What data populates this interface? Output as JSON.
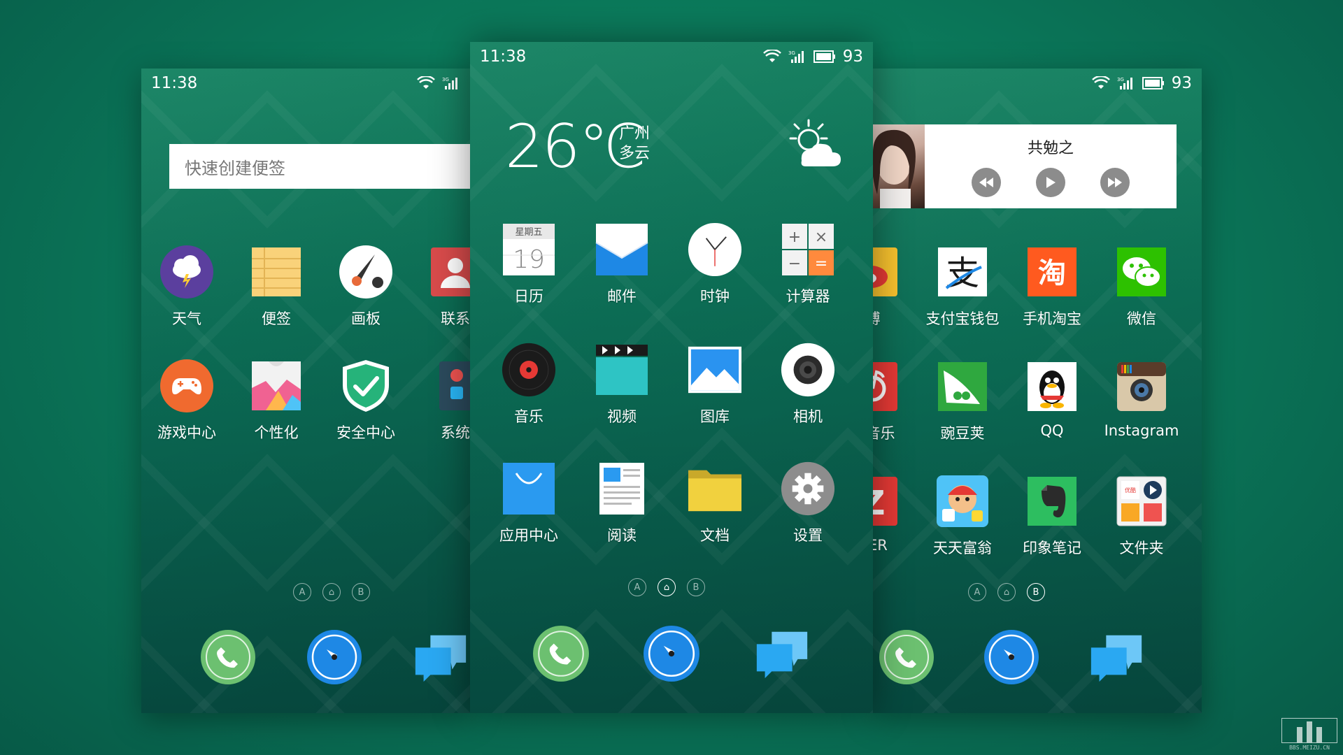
{
  "left_screen": {
    "status": {
      "time": "11:38"
    },
    "note_widget": {
      "placeholder": "快速创建便签"
    },
    "apps_row1": [
      {
        "label": "天气",
        "icon": "weather-icon"
      },
      {
        "label": "便签",
        "icon": "notes-icon"
      },
      {
        "label": "画板",
        "icon": "paint-palette-icon"
      },
      {
        "label": "联系",
        "icon": "contacts-icon"
      }
    ],
    "apps_row2": [
      {
        "label": "游戏中心",
        "icon": "gamepad-icon"
      },
      {
        "label": "个性化",
        "icon": "theme-shirt-icon"
      },
      {
        "label": "安全中心",
        "icon": "shield-check-icon"
      },
      {
        "label": "系统",
        "icon": "system-tools-icon"
      }
    ],
    "dots": [
      "A",
      "⌂",
      "B"
    ]
  },
  "center_screen": {
    "status": {
      "time": "11:38",
      "battery": "93"
    },
    "weather": {
      "temp": "26℃",
      "city": "广州",
      "condition": "多云"
    },
    "apps": [
      {
        "label": "日历",
        "icon": "calendar-icon",
        "weekday": "星期五",
        "day": "19"
      },
      {
        "label": "邮件",
        "icon": "mail-icon"
      },
      {
        "label": "时钟",
        "icon": "clock-icon"
      },
      {
        "label": "计算器",
        "icon": "calculator-icon"
      },
      {
        "label": "音乐",
        "icon": "music-disc-icon"
      },
      {
        "label": "视频",
        "icon": "video-clapper-icon"
      },
      {
        "label": "图库",
        "icon": "gallery-icon"
      },
      {
        "label": "相机",
        "icon": "camera-icon"
      },
      {
        "label": "应用中心",
        "icon": "app-store-bag-icon"
      },
      {
        "label": "阅读",
        "icon": "reader-icon"
      },
      {
        "label": "文档",
        "icon": "folder-icon"
      },
      {
        "label": "设置",
        "icon": "gear-icon"
      }
    ],
    "dots": [
      "A",
      "⌂",
      "B"
    ]
  },
  "right_screen": {
    "status": {
      "battery": "93"
    },
    "music_widget": {
      "title": "共勉之"
    },
    "apps_row1": [
      {
        "label": "博",
        "icon": "weibo-icon"
      },
      {
        "label": "支付宝钱包",
        "icon": "alipay-icon"
      },
      {
        "label": "手机淘宝",
        "icon": "taobao-icon"
      },
      {
        "label": "微信",
        "icon": "wechat-icon"
      }
    ],
    "apps_row2": [
      {
        "label": "云音乐",
        "icon": "netease-music-icon"
      },
      {
        "label": "豌豆荚",
        "icon": "wandoujia-icon"
      },
      {
        "label": "QQ",
        "icon": "qq-penguin-icon"
      },
      {
        "label": "Instagram",
        "icon": "instagram-camera-icon"
      }
    ],
    "apps_row3": [
      {
        "label": "KER",
        "icon": "zaker-icon"
      },
      {
        "label": "天天富翁",
        "icon": "game-rich-icon"
      },
      {
        "label": "印象笔记",
        "icon": "evernote-icon"
      },
      {
        "label": "文件夹",
        "icon": "app-folder-icon"
      }
    ],
    "dots": [
      "A",
      "⌂",
      "B"
    ]
  },
  "dock": [
    {
      "icon": "phone-icon"
    },
    {
      "icon": "browser-compass-icon"
    },
    {
      "icon": "messages-icon"
    }
  ],
  "watermark": {
    "text": "BBS.MEIZU.CN"
  },
  "colors": {
    "background": "#0b7a5b",
    "phone_green": "#6cc070",
    "browser_blue": "#1e88e5",
    "message_blue": "#2aa8f2"
  }
}
